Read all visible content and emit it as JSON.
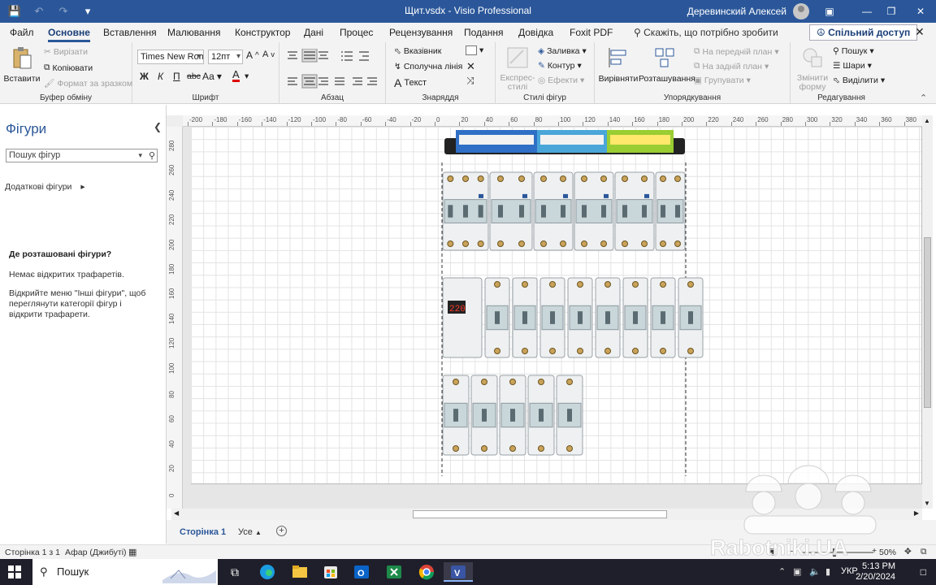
{
  "titlebar": {
    "title": "Щит.vsdx  -  Visio Professional",
    "user": "Деревинский Алексей",
    "qat_icons": [
      "save-icon",
      "undo-icon",
      "redo-icon",
      "customize-qat-icon"
    ],
    "window_controls": [
      "ribbon-display-icon",
      "minimize-icon",
      "maximize-icon",
      "close-icon"
    ]
  },
  "menu": {
    "tabs": [
      "Файл",
      "Основне",
      "Вставлення",
      "Малювання",
      "Конструктор",
      "Дані",
      "Процес",
      "Рецензування",
      "Подання",
      "Довідка",
      "Foxit PDF"
    ],
    "active_tab": "Основне",
    "tell_me": "Скажіть, що потрібно зробити",
    "share": "Спільний доступ"
  },
  "ribbon": {
    "clipboard": {
      "label": "Буфер обміну",
      "paste": "Вставити",
      "cut": "Вирізати",
      "copy": "Копіювати",
      "format_painter": "Формат за зразком"
    },
    "font": {
      "label": "Шрифт",
      "font_name": "Times New Roma",
      "font_size": "12пт",
      "bold": "Ж",
      "italic": "К",
      "underline": "П",
      "strike": "abc",
      "case": "Аа",
      "color": "А"
    },
    "paragraph": {
      "label": "Абзац"
    },
    "tools": {
      "label": "Знаряддя",
      "pointer": "Вказівник",
      "connector": "Сполучна лінія",
      "text": "Текст"
    },
    "styles": {
      "label": "Стилі фігур",
      "quick_styles": "Експрес-стилі",
      "fill": "Заливка",
      "line": "Контур",
      "effects": "Ефекти"
    },
    "arrange": {
      "label": "Упорядкування",
      "align": "Вирівняти",
      "position": "Розташування",
      "bring_front": "На передній план",
      "send_back": "На задній план",
      "group": "Групувати"
    },
    "editing": {
      "label": "Редагування",
      "change_shape": "Змінити форму",
      "find": "Пошук",
      "layers": "Шари",
      "select": "Виділити"
    }
  },
  "shapes_pane": {
    "title": "Фігури",
    "search_placeholder": "Пошук фігур",
    "more_shapes": "Додаткові фігури",
    "where_title": "Де розташовані фігури?",
    "no_stencils": "Немає відкритих трафаретів.",
    "hint": "Відкрийте меню \"Інші фігури\", щоб переглянути категорії фігур і відкрити трафарети."
  },
  "rulers": {
    "horizontal": [
      "-200",
      "-180",
      "-160",
      "-140",
      "-120",
      "-100",
      "-80",
      "-60",
      "-40",
      "-20",
      "0",
      "20",
      "40",
      "60",
      "80",
      "100",
      "120",
      "140",
      "160",
      "180",
      "200",
      "220",
      "240",
      "260",
      "280",
      "300",
      "320",
      "340",
      "360",
      "380"
    ],
    "vertical": [
      "280",
      "260",
      "240",
      "220",
      "200",
      "180",
      "160",
      "140",
      "120",
      "100",
      "80",
      "60",
      "40",
      "20",
      "0"
    ]
  },
  "drawing": {
    "busbar_colors": [
      "#2f6fc6",
      "#4aa6d8",
      "#9acd32"
    ],
    "breakers": {
      "row1": [
        "rcd",
        "rcbo",
        "rcbo",
        "rcbo",
        "rcbo",
        "mcb"
      ],
      "row2": [
        "voltage-relay",
        "mcb",
        "mcb",
        "mcb",
        "mcb",
        "mcb",
        "mcb",
        "mcb",
        "mcb"
      ],
      "row3": [
        "mcb",
        "mcb",
        "mcb",
        "mcb",
        "mcb"
      ]
    },
    "relay_display": "220"
  },
  "page_tabs": {
    "page1": "Сторінка 1",
    "all": "Усе"
  },
  "status": {
    "page": "Сторінка 1 з 1",
    "language": "Афар (Джибуті)",
    "zoom": "50%"
  },
  "taskbar": {
    "search": "Пошук",
    "apps": [
      "task-view-icon",
      "edge-icon",
      "explorer-icon",
      "store-icon",
      "outlook-icon",
      "excel-icon",
      "chrome-icon",
      "visio-icon"
    ],
    "lang": "УКР",
    "time": "5:13 PM",
    "date": "2/20/2024"
  },
  "watermark": "Rabotniki.UA"
}
